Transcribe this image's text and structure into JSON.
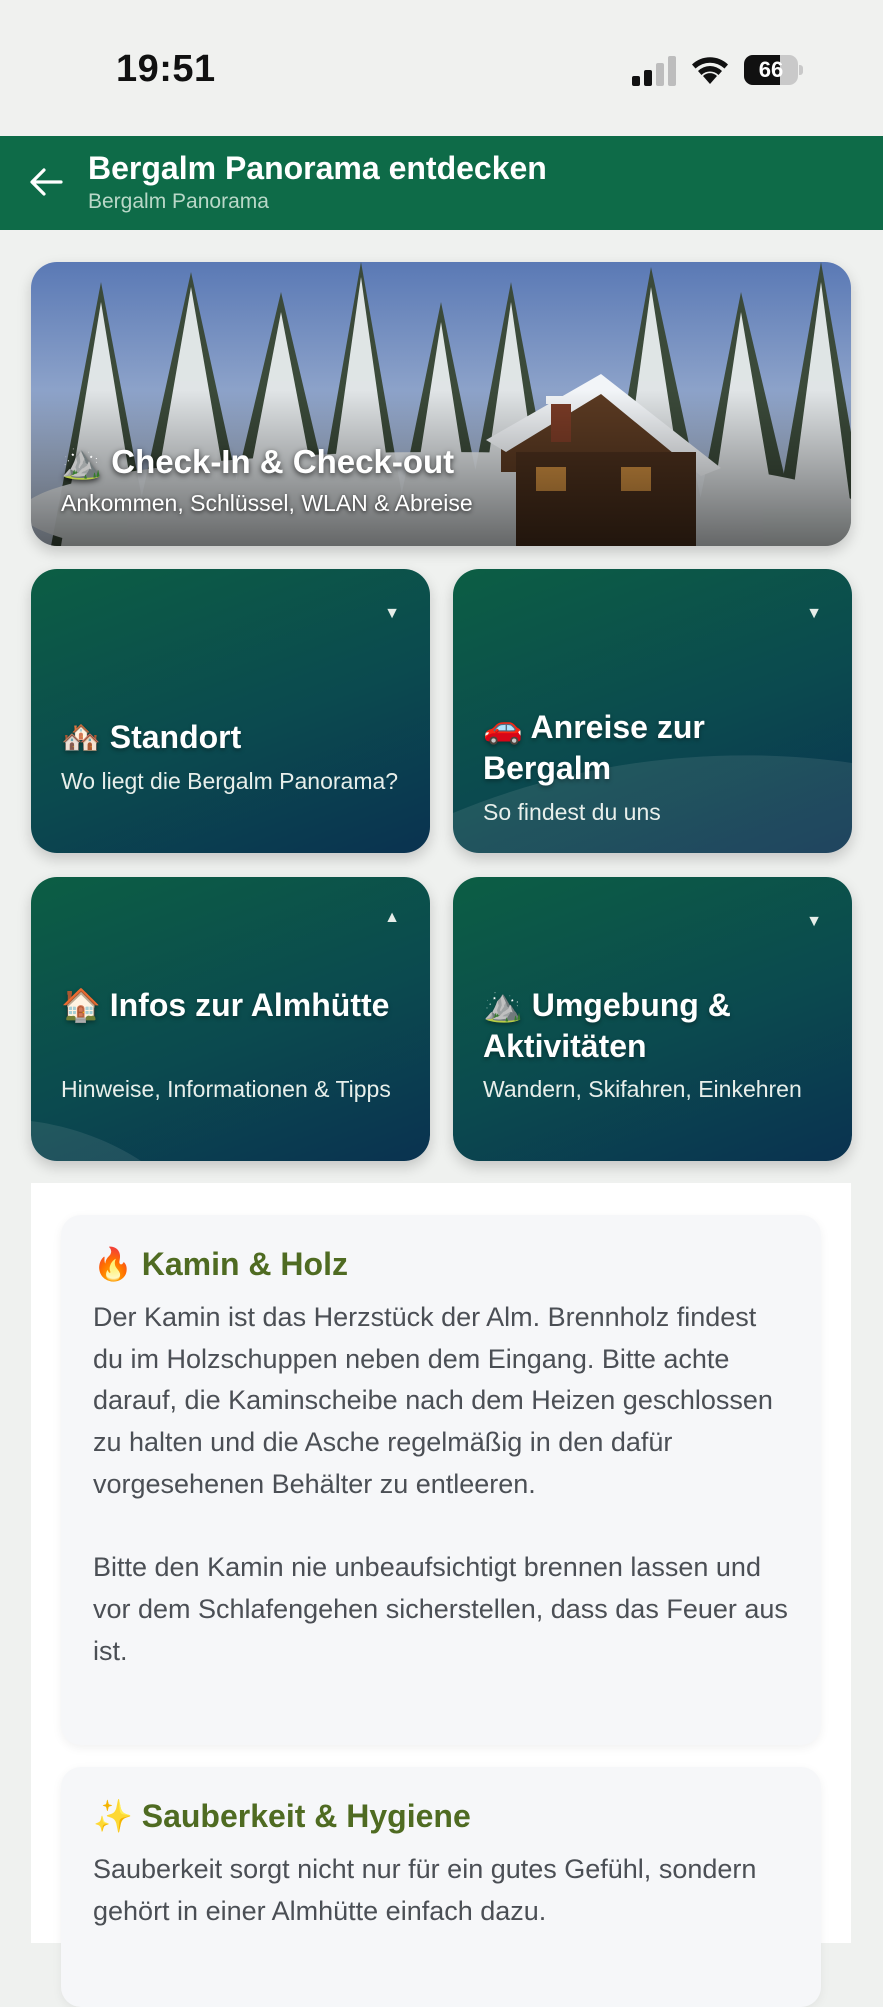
{
  "status_bar": {
    "time": "19:51",
    "battery": "66",
    "battery_level": 0.66
  },
  "header": {
    "title": "Bergalm Panorama entdecken",
    "subtitle": "Bergalm Panorama"
  },
  "hero": {
    "icon": "mountain-emoji",
    "emoji": "⛰️",
    "title": "Check-In & Check-out",
    "subtitle": "Ankommen, Schlüssel, WLAN & Abreise"
  },
  "tiles": [
    {
      "icon": "house-emoji",
      "emoji": "🏘️",
      "title": "Standort",
      "subtitle": "Wo liegt die Bergalm Panorama?",
      "caret": "▼",
      "expanded": false
    },
    {
      "icon": "car-emoji",
      "emoji": "🚗",
      "title": "Anreise zur Bergalm",
      "subtitle": "So findest du uns",
      "caret": "▼",
      "expanded": false
    },
    {
      "icon": "home-emoji",
      "emoji": "🏠",
      "title": "Infos zur Almhütte",
      "subtitle": "Hinweise, Informationen & Tipps",
      "caret": "▲",
      "expanded": true
    },
    {
      "icon": "mountain-emoji",
      "emoji": "⛰️",
      "title": "Umgebung & Aktivitäten",
      "subtitle": "Wandern, Skifahren, Einkehren",
      "caret": "▼",
      "expanded": false
    }
  ],
  "info_cards": [
    {
      "icon": "fire-emoji",
      "emoji": "🔥",
      "title": "Kamin & Holz",
      "text": "Der Kamin ist das Herzstück der Alm. Brennholz findest du im Holzschuppen neben dem Eingang. Bitte achte darauf, die Kaminscheibe nach dem Heizen geschlossen zu halten und die Asche regelmäßig in den dafür vorgesehenen Behälter zu entleeren.\n\nBitte den Kamin nie unbeaufsichtigt brennen lassen und vor dem Schlafengehen sicherstellen, dass das Feuer aus ist."
    },
    {
      "icon": "sparkles-emoji",
      "emoji": "✨",
      "title": "Sauberkeit & Hygiene",
      "text": "Sauberkeit sorgt nicht nur für ein gutes Gefühl, sondern gehört in einer Almhütte einfach dazu."
    }
  ],
  "colors": {
    "app_bar": "#0e6b48",
    "card_title": "#4f6b22",
    "tile_gradient_start": "#0c5e44",
    "tile_gradient_end": "#0a3250"
  }
}
